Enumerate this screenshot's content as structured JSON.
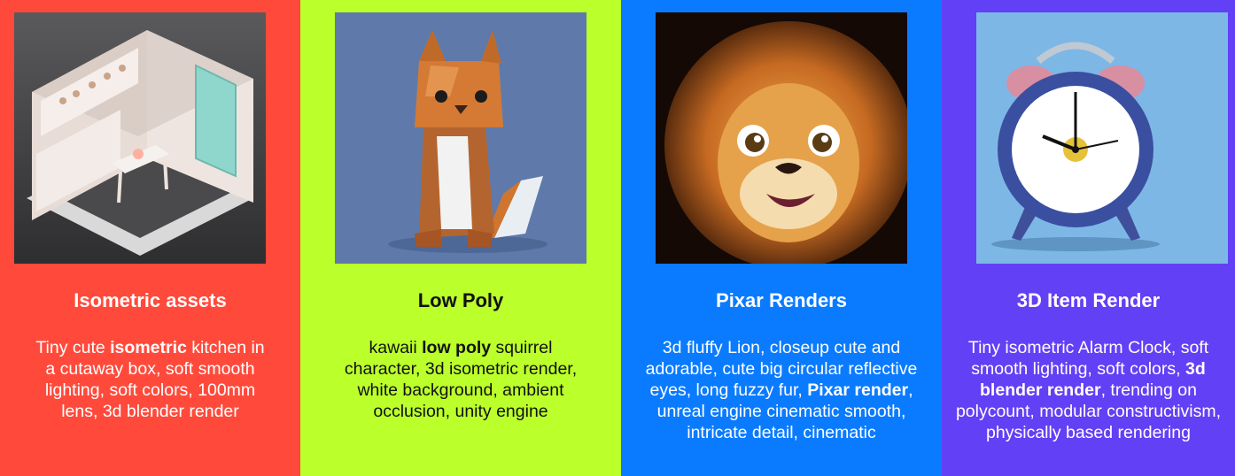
{
  "cards": [
    {
      "title": "Isometric assets",
      "bg": "#FF4A3B",
      "text_color": "#FFFFFF",
      "image_icon": "isometric-kitchen-icon",
      "desc_parts": [
        "Tiny cute ",
        "isometric",
        " kitchen in a cutaway box, soft smooth lighting, soft colors, 100mm lens, 3d blender render"
      ]
    },
    {
      "title": "Low Poly",
      "bg": "#BBFF2B",
      "text_color": "#111111",
      "image_icon": "low-poly-squirrel-icon",
      "desc_parts": [
        "kawaii ",
        "low poly",
        " squirrel character, 3d isometric render, white background, ambient occlusion, unity engine"
      ]
    },
    {
      "title": "Pixar Renders",
      "bg": "#0A7BFF",
      "text_color": "#FFFFFF",
      "image_icon": "pixar-lion-icon",
      "desc_parts": [
        "3d fluffy Lion, closeup cute and adorable, cute big circular reflective eyes, long fuzzy fur, ",
        "Pixar render",
        ", unreal engine cinematic smooth, intricate detail, cinematic"
      ]
    },
    {
      "title": "3D Item Render",
      "bg": "#6240F5",
      "text_color": "#FFFFFF",
      "image_icon": "alarm-clock-icon",
      "desc_parts": [
        "Tiny isometric Alarm Clock, soft smooth lighting,  soft colors,  ",
        "3d blender render",
        ", trending on polycount, modular constructivism, physically based rendering"
      ]
    }
  ]
}
